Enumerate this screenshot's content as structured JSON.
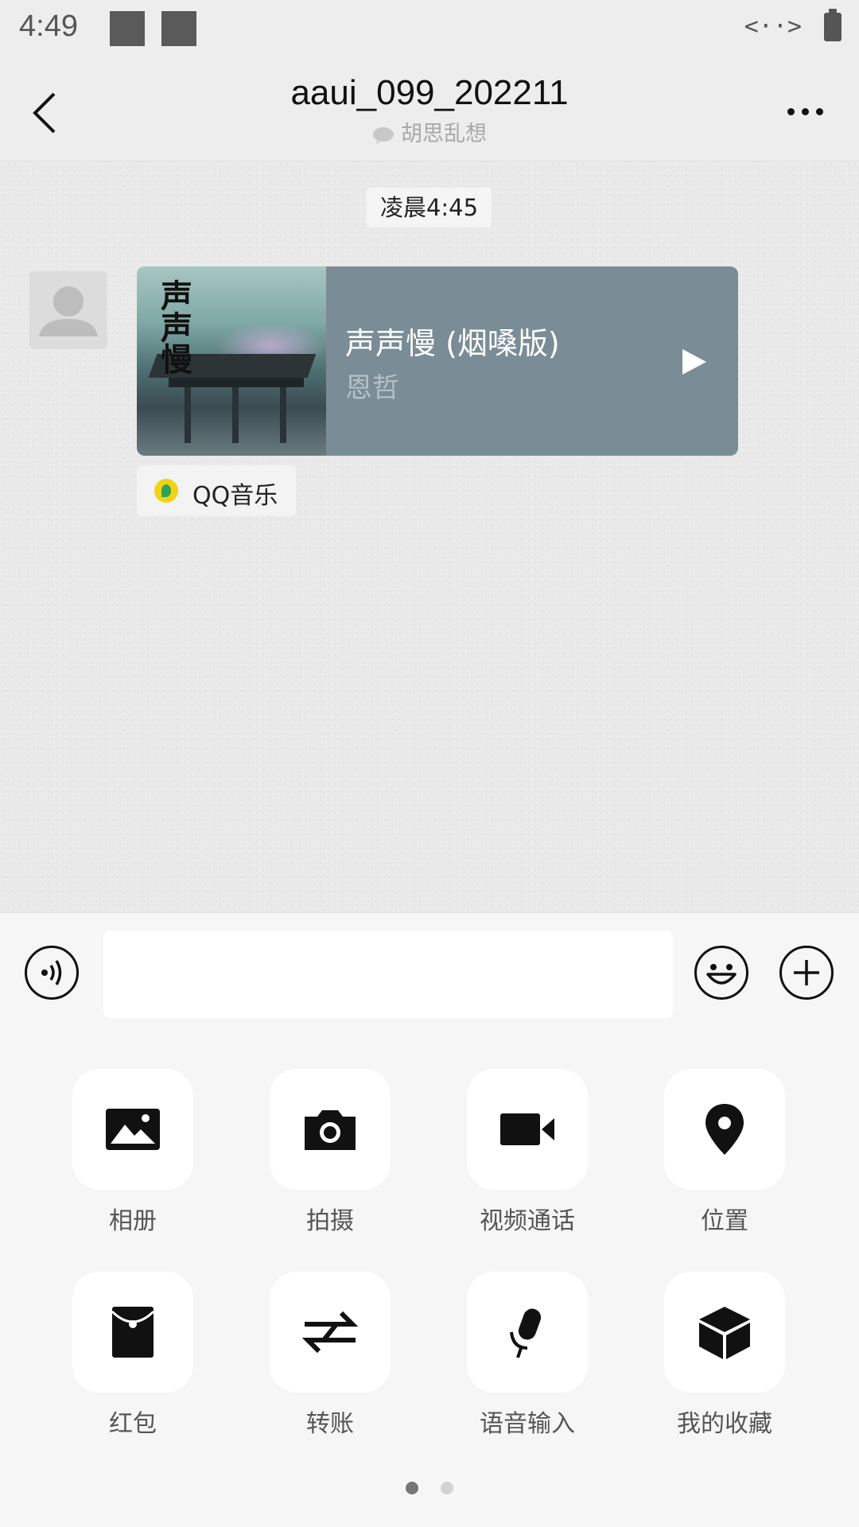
{
  "status_bar": {
    "time": "4:49",
    "network_code": "<··>"
  },
  "header": {
    "title": "aaui_099_202211",
    "subtitle": "胡思乱想"
  },
  "chat": {
    "timestamp": "凌晨4:45",
    "music_card": {
      "song_title": "声声慢 (烟嗓版)",
      "artist": "恩哲",
      "cover_text": "声声慢"
    },
    "source_label": "QQ音乐"
  },
  "input": {
    "placeholder": ""
  },
  "panel": {
    "items": [
      {
        "label": "相册",
        "icon": "photo-icon"
      },
      {
        "label": "拍摄",
        "icon": "camera-icon"
      },
      {
        "label": "视频通话",
        "icon": "video-call-icon"
      },
      {
        "label": "位置",
        "icon": "location-icon"
      },
      {
        "label": "红包",
        "icon": "red-packet-icon"
      },
      {
        "label": "转账",
        "icon": "transfer-icon"
      },
      {
        "label": "语音输入",
        "icon": "microphone-icon"
      },
      {
        "label": "我的收藏",
        "icon": "favorites-icon"
      }
    ],
    "page_count": 2,
    "current_page": 1
  }
}
